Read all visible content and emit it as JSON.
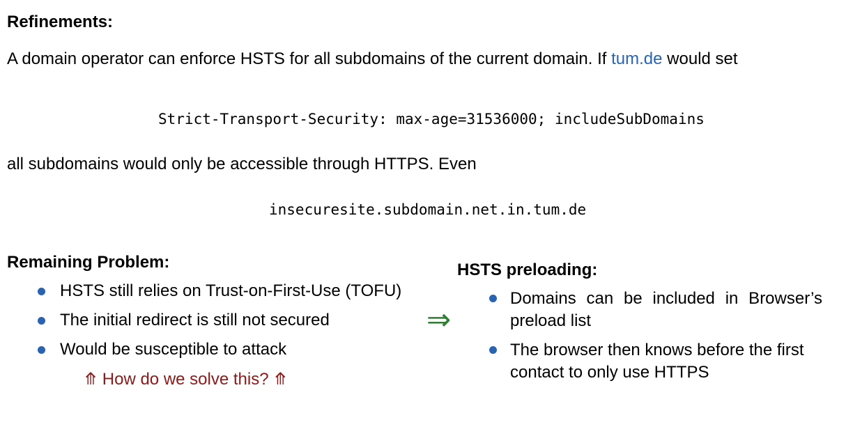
{
  "refinements": {
    "heading": "Refinements:",
    "intro_before_link": "A domain operator can enforce HSTS for all subdomains of the current domain. If ",
    "intro_link": "tum.de",
    "intro_after_link": " would set",
    "header_code": "Strict-Transport-Security: max-age=31536000; includeSubDomains",
    "result_text": "all subdomains would only be accessible through HTTPS. Even",
    "example_domain": "insecuresite.subdomain.net.in.tum.de"
  },
  "remaining_problem": {
    "heading": "Remaining Problem:",
    "items": [
      "HSTS still relies on Trust-on-First-Use (TOFU)",
      "The initial redirect is still not secured",
      "Would be susceptible to attack"
    ],
    "question": "⤊ How do we solve this? ⤊"
  },
  "arrow": "⇒",
  "hsts_preloading": {
    "heading": "HSTS preloading:",
    "items": [
      "Domains can be included in Browser’s preload list",
      "The browser then knows before the first contact to only use HTTPS"
    ]
  },
  "colors": {
    "link": "#2a63b0",
    "bullet": "#2a63b0",
    "question": "#8b1a1a",
    "arrow": "#2e7d32"
  }
}
